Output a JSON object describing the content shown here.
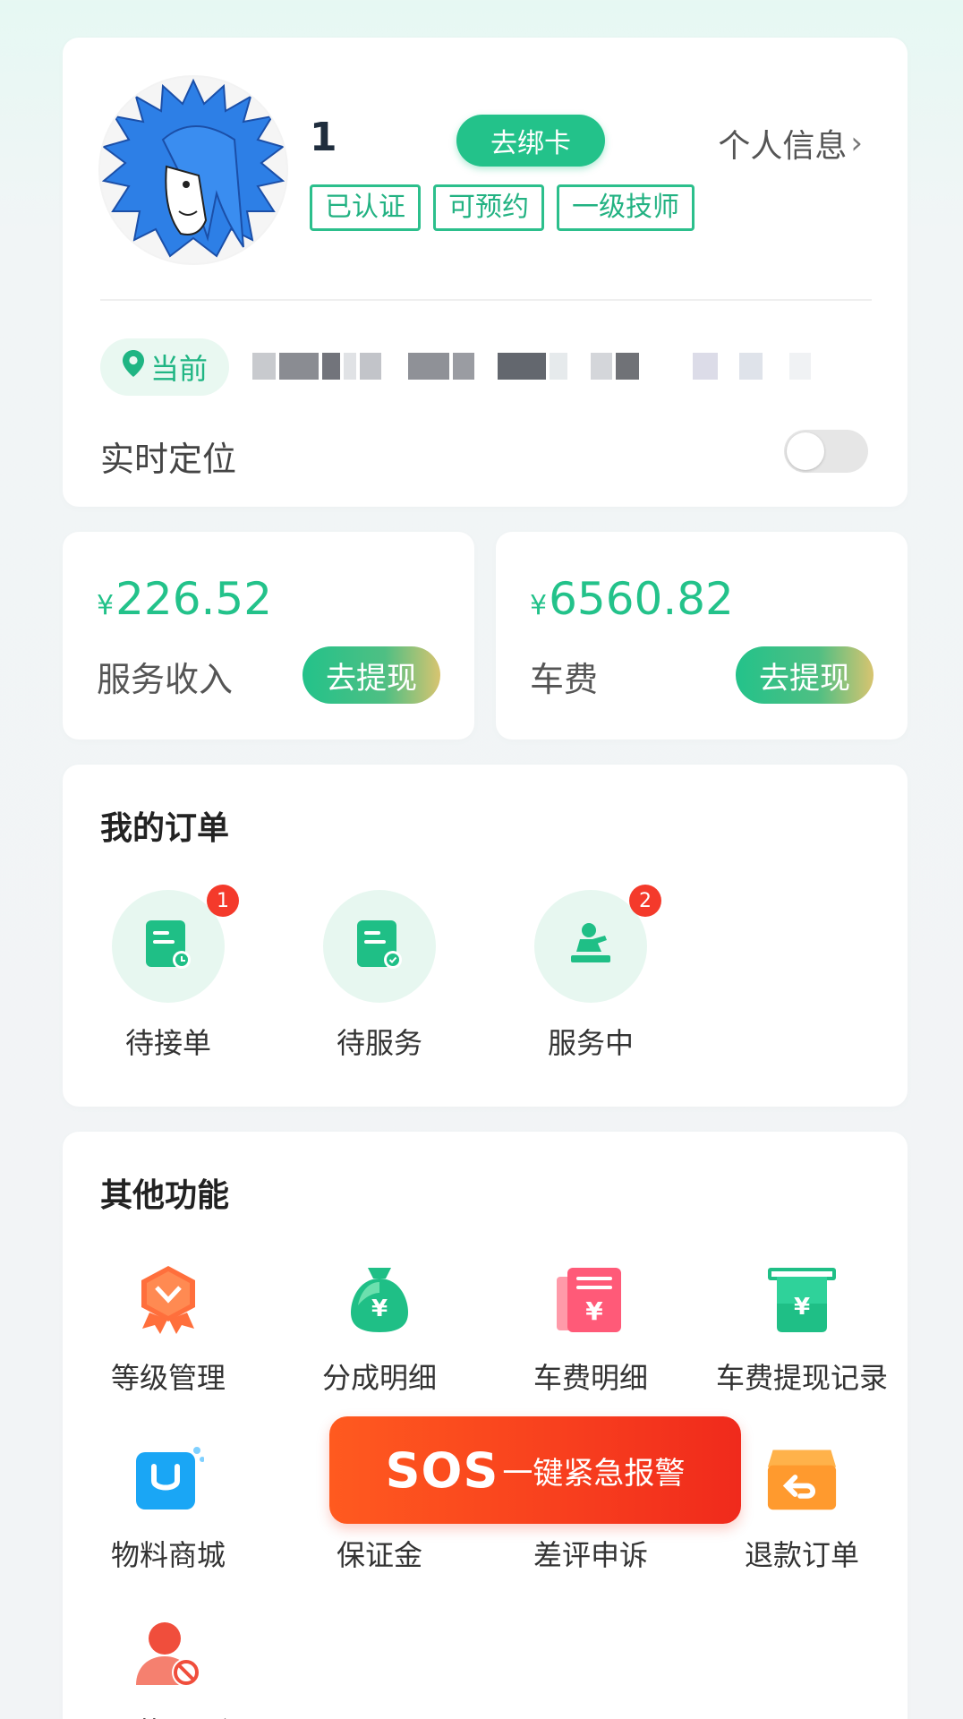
{
  "profile": {
    "username": "1",
    "bind_card_label": "去绑卡",
    "personal_info_label": "个人信息",
    "tags": [
      "已认证",
      "可预约",
      "一级技师"
    ],
    "location_pill_label": "当前",
    "realtime_location_label": "实时定位",
    "realtime_location_on": false
  },
  "money": {
    "service": {
      "currency": "¥",
      "amount": "226.52",
      "label": "服务收入",
      "withdraw_label": "去提现"
    },
    "car": {
      "currency": "¥",
      "amount": "6560.82",
      "label": "车费",
      "withdraw_label": "去提现"
    }
  },
  "orders": {
    "title": "我的订单",
    "items": [
      {
        "label": "待接单",
        "badge": "1",
        "icon": "pending-order-icon"
      },
      {
        "label": "待服务",
        "badge": "",
        "icon": "to-serve-icon"
      },
      {
        "label": "服务中",
        "badge": "2",
        "icon": "in-service-icon"
      }
    ]
  },
  "other": {
    "title": "其他功能",
    "items": [
      {
        "label": "等级管理",
        "icon": "level-medal-icon"
      },
      {
        "label": "分成明细",
        "icon": "money-bag-icon"
      },
      {
        "label": "车费明细",
        "icon": "car-fee-receipt-icon"
      },
      {
        "label": "车费提现记录",
        "icon": "withdraw-record-icon"
      },
      {
        "label": "物料商城",
        "icon": "mall-bag-icon"
      },
      {
        "label": "保证金",
        "icon": "deposit-icon"
      },
      {
        "label": "差评申诉",
        "icon": "appeal-icon"
      },
      {
        "label": "退款订单",
        "icon": "refund-box-icon"
      },
      {
        "label": "回 草 亚 乡",
        "icon": "user-block-icon"
      }
    ]
  },
  "sos": {
    "big": "SOS",
    "small": "一键紧急报警"
  },
  "colors": {
    "accent": "#23c28a",
    "badge": "#f43a2b",
    "sos": "#f8401e"
  }
}
